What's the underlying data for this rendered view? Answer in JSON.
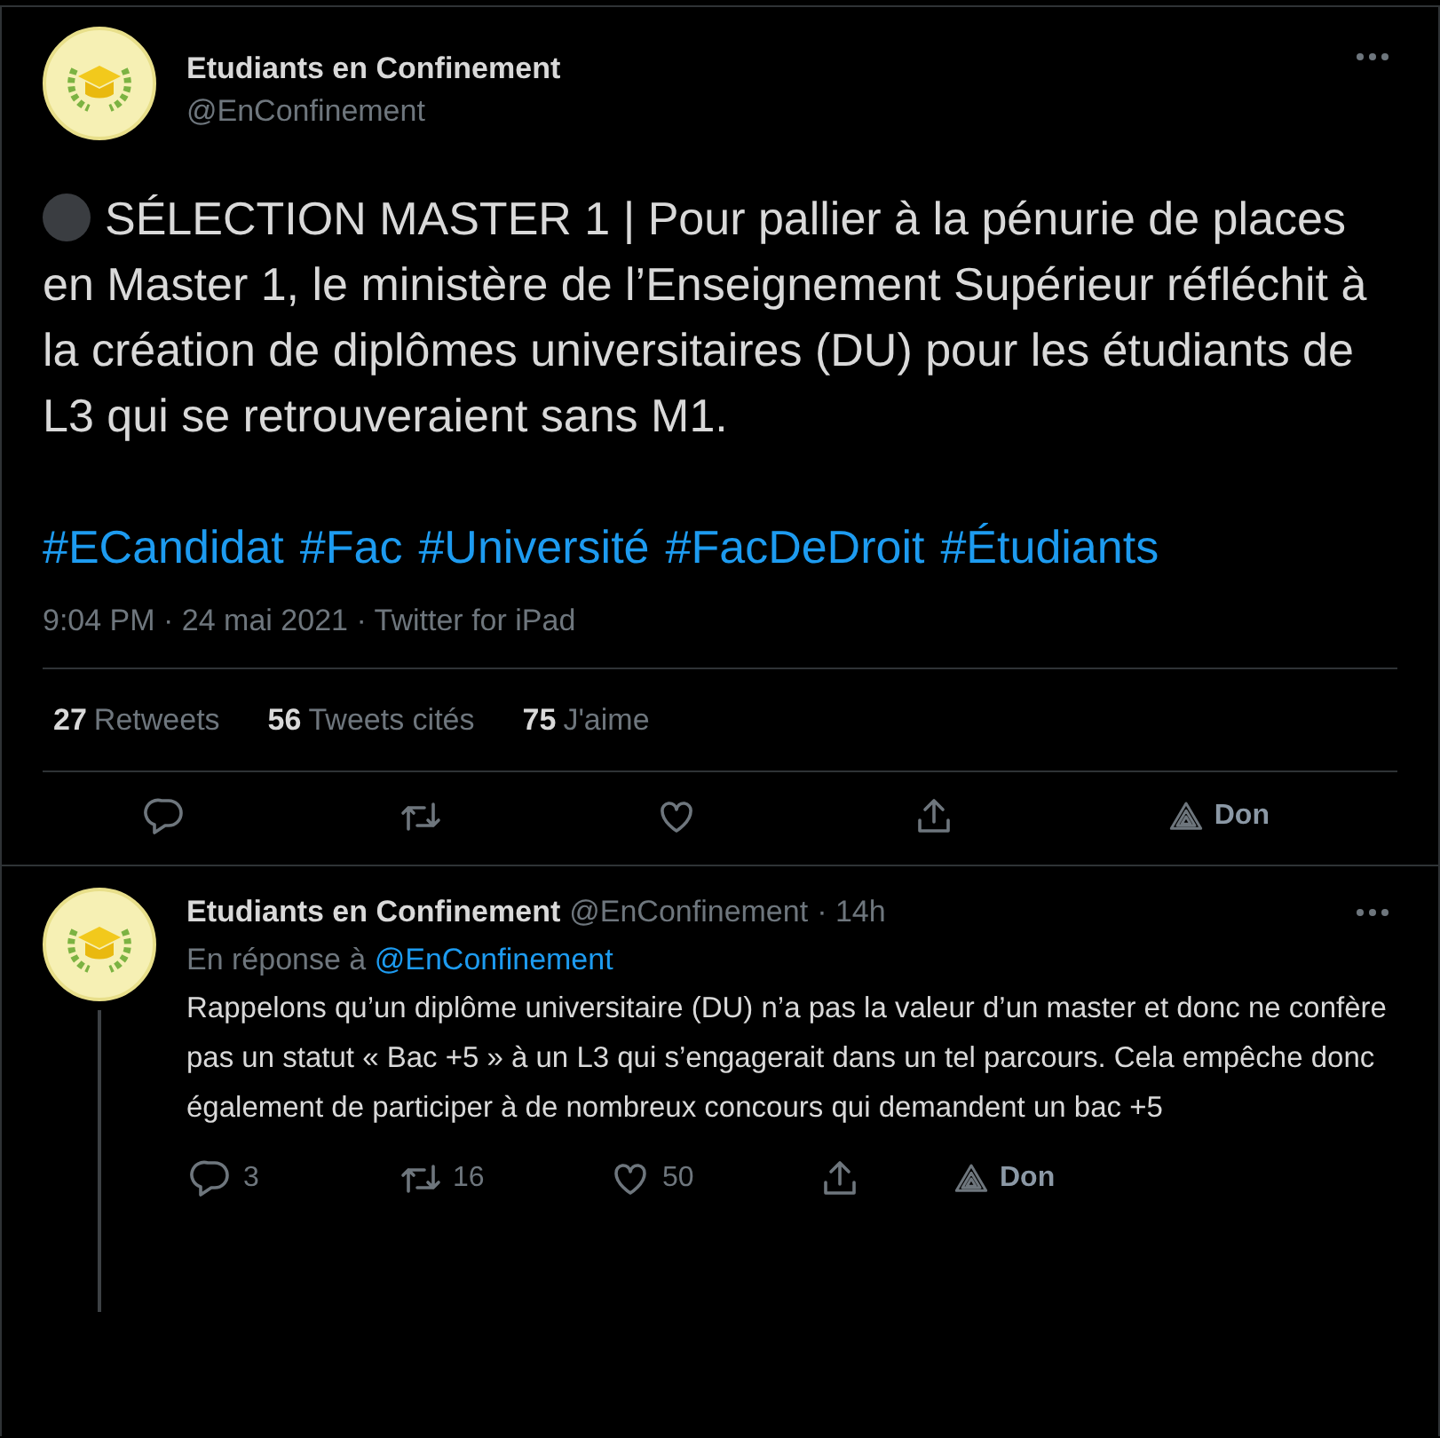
{
  "tweet": {
    "author": {
      "name": "Etudiants en Confinement",
      "handle": "@EnConfinement"
    },
    "body": "SÉLECTION MASTER 1 | Pour pallier à la pénurie de places en Master 1, le ministère de l’Enseignement Supérieur réfléchit à la création de diplômes universitaires (DU) pour les étudiants de L3 qui se retrouveraient sans M1.",
    "hashtags": [
      "#ECandidat",
      "#Fac",
      "#Université",
      "#FacDeDroit",
      "#Étudiants"
    ],
    "timestamp": "9:04 PM · 24 mai 2021 · Twitter for iPad",
    "stats": [
      {
        "count": "27",
        "label": "Retweets"
      },
      {
        "count": "56",
        "label": "Tweets cités"
      },
      {
        "count": "75",
        "label": "J'aime"
      }
    ],
    "actions": [
      {
        "kind": "reply"
      },
      {
        "kind": "retweet"
      },
      {
        "kind": "like"
      },
      {
        "kind": "share"
      },
      {
        "kind": "donate",
        "label": "Don"
      }
    ]
  },
  "reply": {
    "author": {
      "name": "Etudiants en Confinement",
      "handle": "@EnConfinement"
    },
    "time": "· 14h",
    "replying_to_label": "En réponse à",
    "replying_to": "@EnConfinement",
    "body": "Rappelons qu’un diplôme universitaire (DU) n’a pas la valeur d’un master et donc ne confère pas un statut « Bac +5 » à un L3 qui s’engagerait dans un tel parcours. Cela empêche donc également de participer à de nombreux concours qui demandent un bac +5",
    "actions": [
      {
        "kind": "reply",
        "count": "3"
      },
      {
        "kind": "retweet",
        "count": "16"
      },
      {
        "kind": "like",
        "count": "50"
      },
      {
        "kind": "share"
      },
      {
        "kind": "donate",
        "label": "Don"
      }
    ]
  }
}
